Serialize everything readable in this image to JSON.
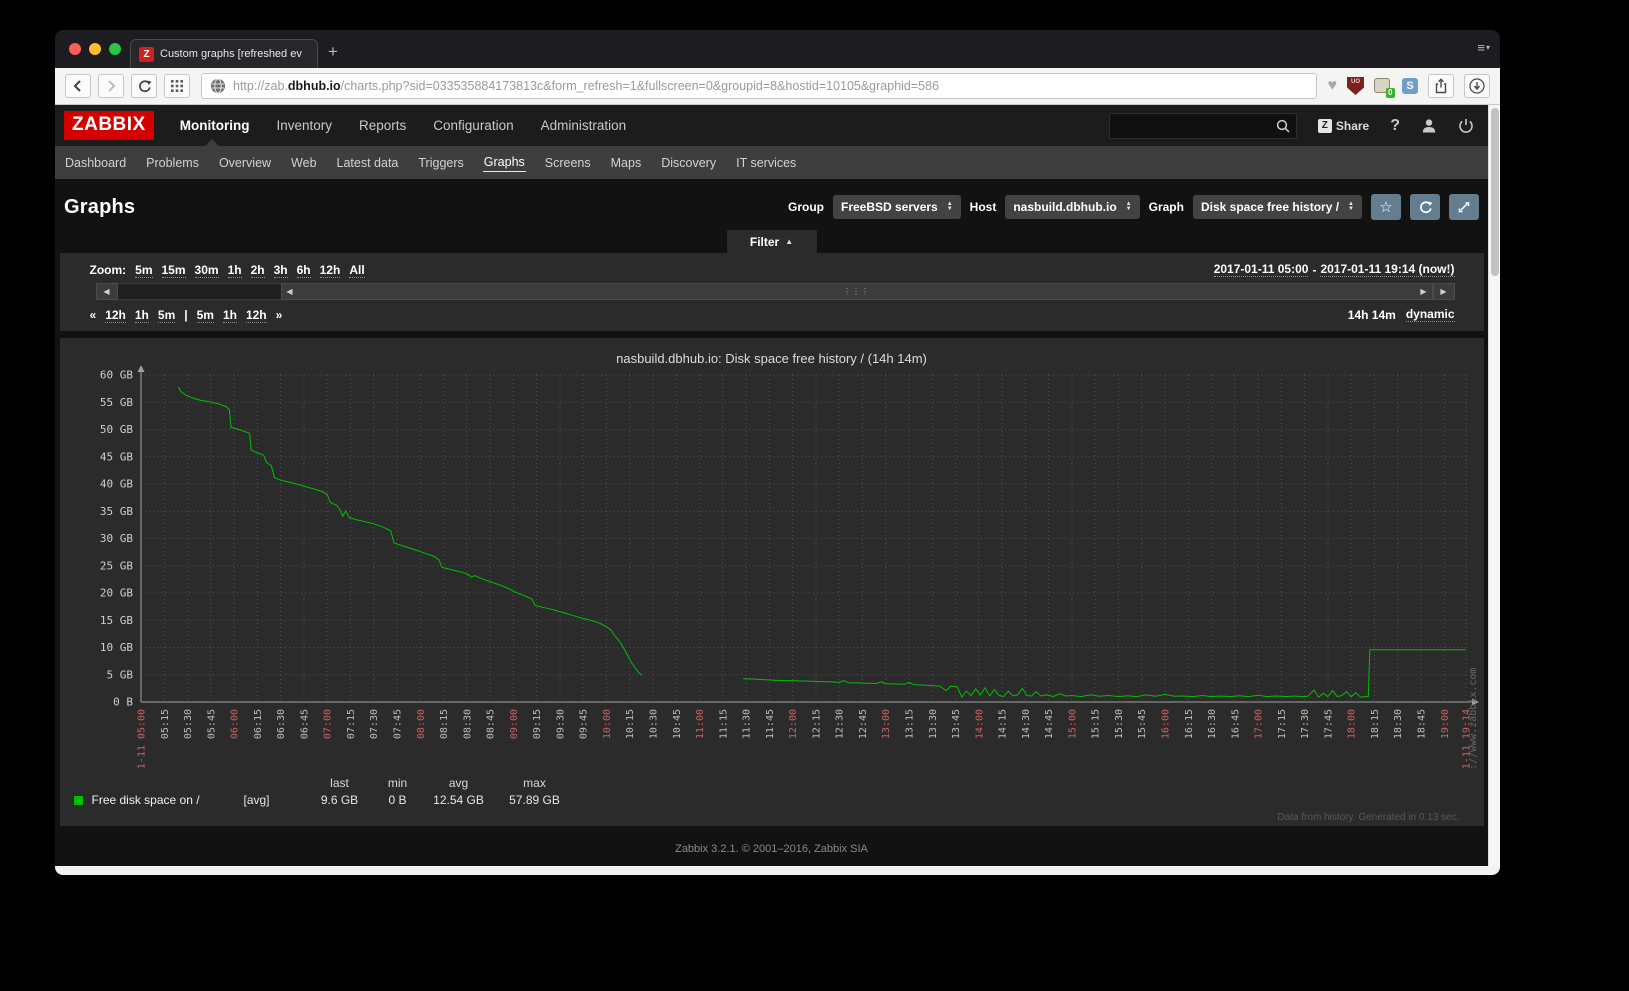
{
  "window": {
    "tab": {
      "title": "Custom graphs [refreshed ev",
      "favicon": "Z"
    },
    "url": {
      "pre": "http://zab.",
      "host": "dbhub.io",
      "path": "/charts.php?sid=033535884173813c&form_refresh=1&fullscreen=0&groupid=8&hostid=10105&graphid=586"
    },
    "ublock_text": "UO",
    "ext_badge": "0",
    "s_letter": "S",
    "icons": {
      "heart": "♥",
      "new_tab": "+",
      "tabs_menu": "≡",
      "caret": "▾"
    }
  },
  "zabbix": {
    "logo": "ZABBIX",
    "menu": [
      {
        "label": "Monitoring",
        "active": true
      },
      {
        "label": "Inventory",
        "active": false
      },
      {
        "label": "Reports",
        "active": false
      },
      {
        "label": "Configuration",
        "active": false
      },
      {
        "label": "Administration",
        "active": false
      }
    ],
    "submenu": [
      {
        "label": "Dashboard",
        "active": false
      },
      {
        "label": "Problems",
        "active": false
      },
      {
        "label": "Overview",
        "active": false
      },
      {
        "label": "Web",
        "active": false
      },
      {
        "label": "Latest data",
        "active": false
      },
      {
        "label": "Triggers",
        "active": false
      },
      {
        "label": "Graphs",
        "active": true
      },
      {
        "label": "Screens",
        "active": false
      },
      {
        "label": "Maps",
        "active": false
      },
      {
        "label": "Discovery",
        "active": false
      },
      {
        "label": "IT services",
        "active": false
      }
    ],
    "share_z": "Z",
    "share_label": "Share",
    "help_label": "?",
    "page_title": "Graphs",
    "controls": {
      "group_label": "Group",
      "group_value": "FreeBSD servers",
      "host_label": "Host",
      "host_value": "nasbuild.dbhub.io",
      "graph_label": "Graph",
      "graph_value": "Disk space free history /"
    },
    "icons": {
      "star": "☆",
      "up": "▲",
      "down": "▼",
      "left": "◀",
      "right": "▶",
      "grip": "⋮⋮⋮"
    },
    "filter": {
      "tab_label": "Filter",
      "tab_arrow": "▲",
      "zoom_label": "Zoom:",
      "zoom_links": [
        "5m",
        "15m",
        "30m",
        "1h",
        "2h",
        "3h",
        "6h",
        "12h",
        "All"
      ],
      "date_from": "2017-01-11 05:00",
      "date_sep": "-",
      "date_to": "2017-01-11 19:14 (now!)",
      "guil_left": "«",
      "guil_right": "»",
      "pipe": "|",
      "nav_left": [
        "12h",
        "1h",
        "5m"
      ],
      "nav_right": [
        "5m",
        "1h",
        "12h"
      ],
      "span_label": "14h 14m",
      "dynamic_label": "dynamic"
    },
    "footer": "Zabbix 3.2.1. © 2001–2016, Zabbix SIA"
  },
  "chart_data": {
    "type": "line",
    "title": "nasbuild.dbhub.io: Disk space free history / (14h 14m)",
    "x_unit": "minutes since 2017-01-11 05:00",
    "xlim": [
      0,
      854
    ],
    "ylim": [
      0,
      60
    ],
    "grid": true,
    "y_ticks": [
      "60 GB",
      "55 GB",
      "50 GB",
      "45 GB",
      "40 GB",
      "35 GB",
      "30 GB",
      "25 GB",
      "20 GB",
      "15 GB",
      "10 GB",
      "5 GB",
      "0 B"
    ],
    "x_ticks": [
      {
        "l": "01-11 05:00",
        "r": 1
      },
      {
        "l": "05:15",
        "r": 0
      },
      {
        "l": "05:30",
        "r": 0
      },
      {
        "l": "05:45",
        "r": 0
      },
      {
        "l": "06:00",
        "r": 1
      },
      {
        "l": "06:15",
        "r": 0
      },
      {
        "l": "06:30",
        "r": 0
      },
      {
        "l": "06:45",
        "r": 0
      },
      {
        "l": "07:00",
        "r": 1
      },
      {
        "l": "07:15",
        "r": 0
      },
      {
        "l": "07:30",
        "r": 0
      },
      {
        "l": "07:45",
        "r": 0
      },
      {
        "l": "08:00",
        "r": 1
      },
      {
        "l": "08:15",
        "r": 0
      },
      {
        "l": "08:30",
        "r": 0
      },
      {
        "l": "08:45",
        "r": 0
      },
      {
        "l": "09:00",
        "r": 1
      },
      {
        "l": "09:15",
        "r": 0
      },
      {
        "l": "09:30",
        "r": 0
      },
      {
        "l": "09:45",
        "r": 0
      },
      {
        "l": "10:00",
        "r": 1
      },
      {
        "l": "10:15",
        "r": 0
      },
      {
        "l": "10:30",
        "r": 0
      },
      {
        "l": "10:45",
        "r": 0
      },
      {
        "l": "11:00",
        "r": 1
      },
      {
        "l": "11:15",
        "r": 0
      },
      {
        "l": "11:30",
        "r": 0
      },
      {
        "l": "11:45",
        "r": 0
      },
      {
        "l": "12:00",
        "r": 1
      },
      {
        "l": "12:15",
        "r": 0
      },
      {
        "l": "12:30",
        "r": 0
      },
      {
        "l": "12:45",
        "r": 0
      },
      {
        "l": "13:00",
        "r": 1
      },
      {
        "l": "13:15",
        "r": 0
      },
      {
        "l": "13:30",
        "r": 0
      },
      {
        "l": "13:45",
        "r": 0
      },
      {
        "l": "14:00",
        "r": 1
      },
      {
        "l": "14:15",
        "r": 0
      },
      {
        "l": "14:30",
        "r": 0
      },
      {
        "l": "14:45",
        "r": 0
      },
      {
        "l": "15:00",
        "r": 1
      },
      {
        "l": "15:15",
        "r": 0
      },
      {
        "l": "15:30",
        "r": 0
      },
      {
        "l": "15:45",
        "r": 0
      },
      {
        "l": "16:00",
        "r": 1
      },
      {
        "l": "16:15",
        "r": 0
      },
      {
        "l": "16:30",
        "r": 0
      },
      {
        "l": "16:45",
        "r": 0
      },
      {
        "l": "17:00",
        "r": 1
      },
      {
        "l": "17:15",
        "r": 0
      },
      {
        "l": "17:30",
        "r": 0
      },
      {
        "l": "17:45",
        "r": 0
      },
      {
        "l": "18:00",
        "r": 1
      },
      {
        "l": "18:15",
        "r": 0
      },
      {
        "l": "18:30",
        "r": 0
      },
      {
        "l": "18:45",
        "r": 0
      },
      {
        "l": "19:00",
        "r": 1
      },
      {
        "l": "01-11 19:14",
        "r": 1
      }
    ],
    "series": [
      {
        "name": "Free disk space on /",
        "mode": "[avg]",
        "color": "#00bf00",
        "segments": [
          [
            [
              1,
              0.1
            ],
            [
              5,
              0.1
            ]
          ],
          [
            [
              24,
              57.8
            ],
            [
              26,
              56.9
            ],
            [
              29,
              56.3
            ],
            [
              33,
              55.8
            ],
            [
              38,
              55.4
            ],
            [
              44,
              55.1
            ],
            [
              50,
              54.7
            ],
            [
              55,
              54.2
            ],
            [
              57,
              53.6
            ],
            [
              58,
              50.4
            ],
            [
              62,
              50.1
            ],
            [
              66,
              49.7
            ],
            [
              70,
              49.3
            ],
            [
              71,
              46.2
            ],
            [
              75,
              45.7
            ],
            [
              79,
              45.3
            ],
            [
              81,
              43.9
            ],
            [
              84,
              43.4
            ],
            [
              86,
              41.2
            ],
            [
              90,
              40.7
            ],
            [
              96,
              40.3
            ],
            [
              103,
              39.8
            ],
            [
              110,
              39.2
            ],
            [
              117,
              38.6
            ],
            [
              120,
              38.1
            ],
            [
              122,
              36.6
            ],
            [
              126,
              36.1
            ],
            [
              128,
              35.4
            ],
            [
              130,
              34.1
            ],
            [
              132,
              35.1
            ],
            [
              134,
              33.9
            ],
            [
              138,
              33.5
            ],
            [
              144,
              33.1
            ],
            [
              150,
              32.7
            ],
            [
              156,
              32.1
            ],
            [
              161,
              31.4
            ],
            [
              163,
              29.2
            ],
            [
              168,
              28.7
            ],
            [
              175,
              28.1
            ],
            [
              182,
              27.4
            ],
            [
              189,
              26.7
            ],
            [
              192,
              26.1
            ],
            [
              194,
              24.7
            ],
            [
              200,
              24.3
            ],
            [
              207,
              23.8
            ],
            [
              211,
              23.4
            ],
            [
              213,
              22.9
            ],
            [
              215,
              23.2
            ],
            [
              219,
              22.7
            ],
            [
              225,
              22.1
            ],
            [
              231,
              21.5
            ],
            [
              237,
              20.8
            ],
            [
              241,
              20.2
            ],
            [
              247,
              19.5
            ],
            [
              252,
              18.9
            ],
            [
              254,
              17.7
            ],
            [
              260,
              17.3
            ],
            [
              266,
              16.9
            ],
            [
              272,
              16.4
            ],
            [
              278,
              15.9
            ],
            [
              284,
              15.4
            ],
            [
              290,
              15.0
            ],
            [
              296,
              14.4
            ],
            [
              300,
              13.8
            ],
            [
              303,
              13.2
            ],
            [
              305,
              12.3
            ],
            [
              307,
              11.6
            ],
            [
              309,
              10.9
            ],
            [
              311,
              9.9
            ],
            [
              313,
              8.9
            ],
            [
              315,
              7.8
            ],
            [
              317,
              6.9
            ],
            [
              319,
              6.1
            ],
            [
              321,
              5.4
            ],
            [
              323,
              4.9
            ]
          ],
          [
            [
              388,
              4.3
            ],
            [
              395,
              4.2
            ],
            [
              402,
              4.1
            ],
            [
              408,
              4.0
            ],
            [
              414,
              3.95
            ],
            [
              420,
              3.9
            ],
            [
              426,
              3.85
            ],
            [
              432,
              3.8
            ],
            [
              438,
              3.75
            ],
            [
              444,
              3.7
            ],
            [
              450,
              3.6
            ],
            [
              453,
              3.9
            ],
            [
              456,
              3.5
            ],
            [
              462,
              3.5
            ],
            [
              468,
              3.45
            ],
            [
              474,
              3.4
            ],
            [
              477,
              3.7
            ],
            [
              480,
              3.35
            ],
            [
              486,
              3.3
            ],
            [
              492,
              3.25
            ],
            [
              495,
              3.6
            ],
            [
              498,
              3.2
            ],
            [
              504,
              3.1
            ],
            [
              510,
              3.0
            ],
            [
              515,
              2.9
            ],
            [
              519,
              2.1
            ],
            [
              522,
              2.9
            ],
            [
              526,
              2.8
            ],
            [
              529,
              0.9
            ],
            [
              532,
              2.0
            ],
            [
              535,
              1.2
            ],
            [
              538,
              2.4
            ],
            [
              541,
              1.3
            ],
            [
              544,
              2.6
            ],
            [
              547,
              1.1
            ],
            [
              550,
              2.3
            ],
            [
              553,
              1.2
            ],
            [
              556,
              1.0
            ],
            [
              559,
              2.0
            ],
            [
              562,
              1.1
            ],
            [
              565,
              1.3
            ],
            [
              568,
              2.5
            ],
            [
              571,
              1.2
            ],
            [
              574,
              1.1
            ],
            [
              577,
              1.9
            ],
            [
              580,
              1.1
            ],
            [
              584,
              1.3
            ],
            [
              588,
              1.0
            ],
            [
              592,
              1.5
            ],
            [
              596,
              1.1
            ],
            [
              600,
              1.2
            ],
            [
              606,
              1.0
            ],
            [
              612,
              1.3
            ],
            [
              618,
              1.05
            ],
            [
              624,
              1.2
            ],
            [
              630,
              1.0
            ],
            [
              636,
              1.15
            ],
            [
              642,
              1.0
            ],
            [
              648,
              1.3
            ],
            [
              654,
              1.05
            ],
            [
              660,
              1.4
            ],
            [
              666,
              1.05
            ],
            [
              672,
              1.1
            ],
            [
              678,
              1.0
            ],
            [
              684,
              1.2
            ],
            [
              690,
              1.0
            ],
            [
              696,
              1.1
            ],
            [
              702,
              1.0
            ],
            [
              708,
              1.15
            ],
            [
              714,
              1.0
            ],
            [
              720,
              1.25
            ],
            [
              726,
              1.0
            ],
            [
              732,
              1.1
            ],
            [
              738,
              1.0
            ],
            [
              744,
              1.1
            ],
            [
              748,
              1.0
            ],
            [
              752,
              1.05
            ],
            [
              756,
              2.2
            ],
            [
              759,
              0.9
            ],
            [
              762,
              1.6
            ],
            [
              765,
              0.95
            ],
            [
              768,
              2.1
            ],
            [
              771,
              1.0
            ],
            [
              774,
              1.2
            ],
            [
              777,
              1.9
            ],
            [
              780,
              0.95
            ],
            [
              783,
              1.7
            ],
            [
              786,
              0.9
            ],
            [
              789,
              1.0
            ],
            [
              791,
              1.0
            ],
            [
              792,
              9.6
            ],
            [
              854,
              9.6
            ]
          ]
        ]
      }
    ],
    "legend": {
      "headers": [
        "last",
        "min",
        "avg",
        "max"
      ],
      "rows": [
        {
          "name": "Free disk space on /",
          "tag": "[avg]",
          "last": "9.6 GB",
          "min": "0 B",
          "avg": "12.54 GB",
          "max": "57.89 GB"
        }
      ]
    },
    "watermark": "http://www.zabbix.com",
    "footnote": "Data from history. Generated in 0.13 sec."
  }
}
